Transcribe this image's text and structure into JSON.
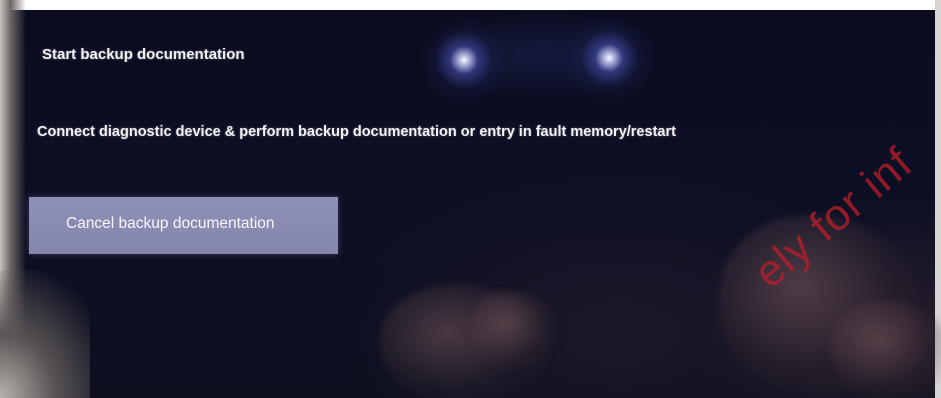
{
  "screen": {
    "title": "Start backup documentation",
    "message": "Connect diagnostic device & perform backup documentation or entry in fault memory/restart",
    "cancel_button_label": "Cancel backup documentation"
  },
  "watermark": {
    "text": "ely for inf"
  },
  "colors": {
    "background": "#0b0d1a",
    "button": "#8a8cb2",
    "text": "#f2f2f6",
    "watermark": "#be1e28"
  }
}
